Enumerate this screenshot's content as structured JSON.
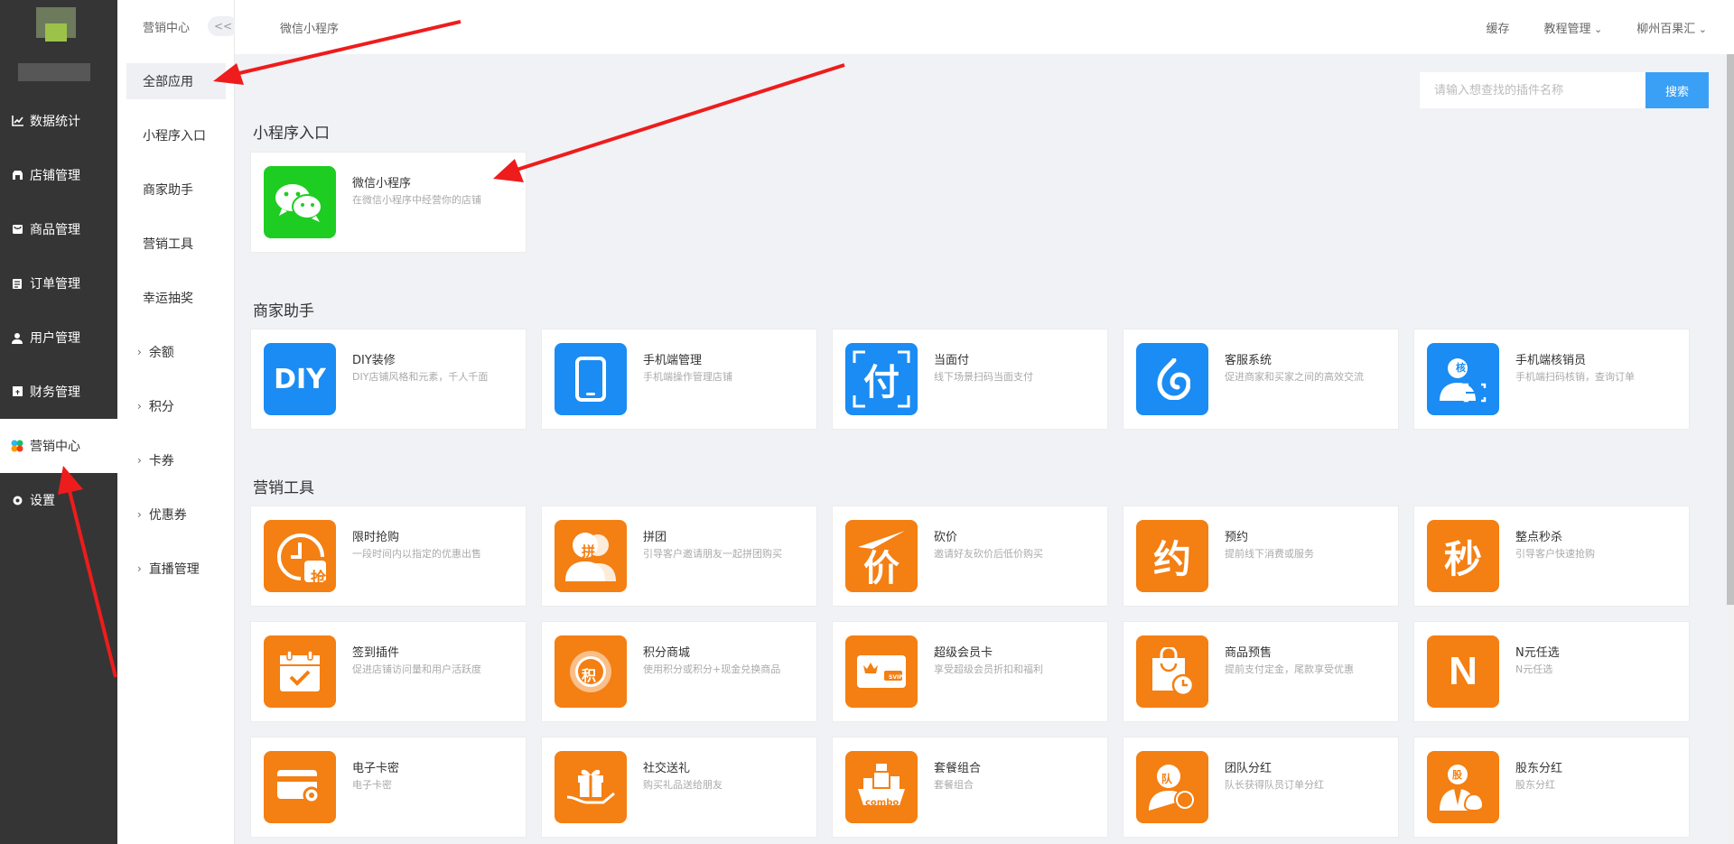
{
  "sidebar": {
    "items": [
      {
        "label": "数据统计",
        "icon": "chart-line-icon"
      },
      {
        "label": "店铺管理",
        "icon": "store-icon"
      },
      {
        "label": "商品管理",
        "icon": "goods-icon"
      },
      {
        "label": "订单管理",
        "icon": "order-icon"
      },
      {
        "label": "用户管理",
        "icon": "user-icon"
      },
      {
        "label": "财务管理",
        "icon": "finance-icon"
      },
      {
        "label": "营销中心",
        "icon": "marketing-icon"
      },
      {
        "label": "设置",
        "icon": "gear-icon"
      }
    ],
    "active": "营销中心"
  },
  "subnav": {
    "crumb": "营销中心",
    "collapse": "<<",
    "items": [
      {
        "label": "全部应用"
      },
      {
        "label": "小程序入口"
      },
      {
        "label": "商家助手"
      },
      {
        "label": "营销工具"
      },
      {
        "label": "幸运抽奖"
      },
      {
        "label": "余额"
      },
      {
        "label": "积分"
      },
      {
        "label": "卡券"
      },
      {
        "label": "优惠券"
      },
      {
        "label": "直播管理"
      }
    ]
  },
  "topbar": {
    "title": "微信小程序",
    "cache": "缓存",
    "tutorial": "教程管理",
    "account": "柳州百果汇"
  },
  "search": {
    "placeholder": "请输入想查找的插件名称",
    "button": "搜索"
  },
  "sections": {
    "miniapp": {
      "title": "小程序入口",
      "cards": [
        {
          "name": "微信小程序",
          "desc": "在微信小程序中经营你的店铺",
          "icon": "wechat-icon",
          "color": "#1ecd22"
        }
      ]
    },
    "assistant": {
      "title": "商家助手",
      "cards": [
        {
          "name": "DIY装修",
          "desc": "DIY店铺风格和元素，千人千面",
          "icon": "diy-icon",
          "glyph": "DIY",
          "color": "#1a8cf4"
        },
        {
          "name": "手机端管理",
          "desc": "手机端操作管理店铺",
          "icon": "phone-icon",
          "color": "#1a8cf4"
        },
        {
          "name": "当面付",
          "desc": "线下场景扫码当面支付",
          "icon": "pay-icon",
          "glyph": "付",
          "color": "#1a8cf4"
        },
        {
          "name": "客服系统",
          "desc": "促进商家和买家之间的高效交流",
          "icon": "customer-service-icon",
          "color": "#1a8cf4"
        },
        {
          "name": "手机端核销员",
          "desc": "手机端扫码核销，查询订单",
          "icon": "verifier-icon",
          "glyph": "核",
          "color": "#1a8cf4"
        }
      ]
    },
    "marketing": {
      "title": "营销工具",
      "cards": [
        {
          "name": "限时抢购",
          "desc": "一段时间内以指定的优惠出售",
          "icon": "flash-sale-icon",
          "glyph": "抢"
        },
        {
          "name": "拼团",
          "desc": "引导客户邀请朋友一起拼团购买",
          "icon": "group-buy-icon",
          "glyph": "拼"
        },
        {
          "name": "砍价",
          "desc": "邀请好友砍价后低价购买",
          "icon": "bargain-icon",
          "glyph": "价"
        },
        {
          "name": "预约",
          "desc": "提前线下消费或服务",
          "icon": "reservation-icon",
          "glyph": "约"
        },
        {
          "name": "整点秒杀",
          "desc": "引导客户快速抢购",
          "icon": "seckill-icon",
          "glyph": "秒"
        },
        {
          "name": "签到插件",
          "desc": "促进店铺访问量和用户活跃度",
          "icon": "calendar-check-icon"
        },
        {
          "name": "积分商城",
          "desc": "使用积分或积分+现金兑换商品",
          "icon": "points-mall-icon",
          "glyph": "积"
        },
        {
          "name": "超级会员卡",
          "desc": "享受超级会员折扣和福利",
          "icon": "svip-card-icon",
          "glyph": "SVIP"
        },
        {
          "name": "商品预售",
          "desc": "提前支付定金，尾款享受优惠",
          "icon": "presale-bag-icon"
        },
        {
          "name": "N元任选",
          "desc": "N元任选",
          "icon": "n-choice-icon",
          "glyph": "N"
        },
        {
          "name": "电子卡密",
          "desc": "电子卡密",
          "icon": "ecard-icon"
        },
        {
          "name": "社交送礼",
          "desc": "购买礼品送给朋友",
          "icon": "gift-icon"
        },
        {
          "name": "套餐组合",
          "desc": "套餐组合",
          "icon": "combo-icon",
          "glyph": "combo"
        },
        {
          "name": "团队分红",
          "desc": "队长获得队员订单分红",
          "icon": "team-bonus-icon",
          "glyph": "队"
        },
        {
          "name": "股东分红",
          "desc": "股东分红",
          "icon": "shareholder-bonus-icon",
          "glyph": "股"
        }
      ]
    }
  },
  "colors": {
    "accent": "#3aa0f5",
    "green": "#1ecd22",
    "blue": "#1a8cf4",
    "orange": "#f47f12",
    "sidebar": "#353535",
    "arrow": "#ee1c1c"
  }
}
